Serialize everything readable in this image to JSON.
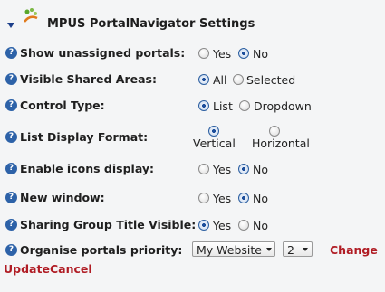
{
  "header": {
    "title": "MPUS PortalNavigator Settings"
  },
  "settings": [
    {
      "label": "Show unassigned portals:",
      "options": [
        "Yes",
        "No"
      ],
      "selected": "No"
    },
    {
      "label": "Visible Shared Areas:",
      "options": [
        "All",
        "Selected"
      ],
      "selected": "All"
    },
    {
      "label": "Control Type:",
      "options": [
        "List",
        "Dropdown"
      ],
      "selected": "List"
    },
    {
      "label": "List Display Format:",
      "options": [
        "Vertical",
        "Horizontal"
      ],
      "selected": "Vertical"
    },
    {
      "label": "Enable icons display:",
      "options": [
        "Yes",
        "No"
      ],
      "selected": "No"
    },
    {
      "label": "New window:",
      "options": [
        "Yes",
        "No"
      ],
      "selected": "No"
    },
    {
      "label": "Sharing Group Title Visible:",
      "options": [
        "Yes",
        "No"
      ],
      "selected": "Yes"
    }
  ],
  "priority": {
    "label": "Organise portals priority:",
    "portal_select": "My Website",
    "rank_select": "2",
    "change_label": "Change"
  },
  "actions": {
    "update_label": "Update",
    "cancel_label": "Cancel"
  },
  "icons": {
    "help": "help-icon",
    "collapse": "collapse-arrow-icon",
    "logo": "mpus-logo-icon"
  },
  "colors": {
    "accent_link": "#b01c24",
    "help_icon": "#2d62a8",
    "radio_selected": "#1d4e9b"
  }
}
